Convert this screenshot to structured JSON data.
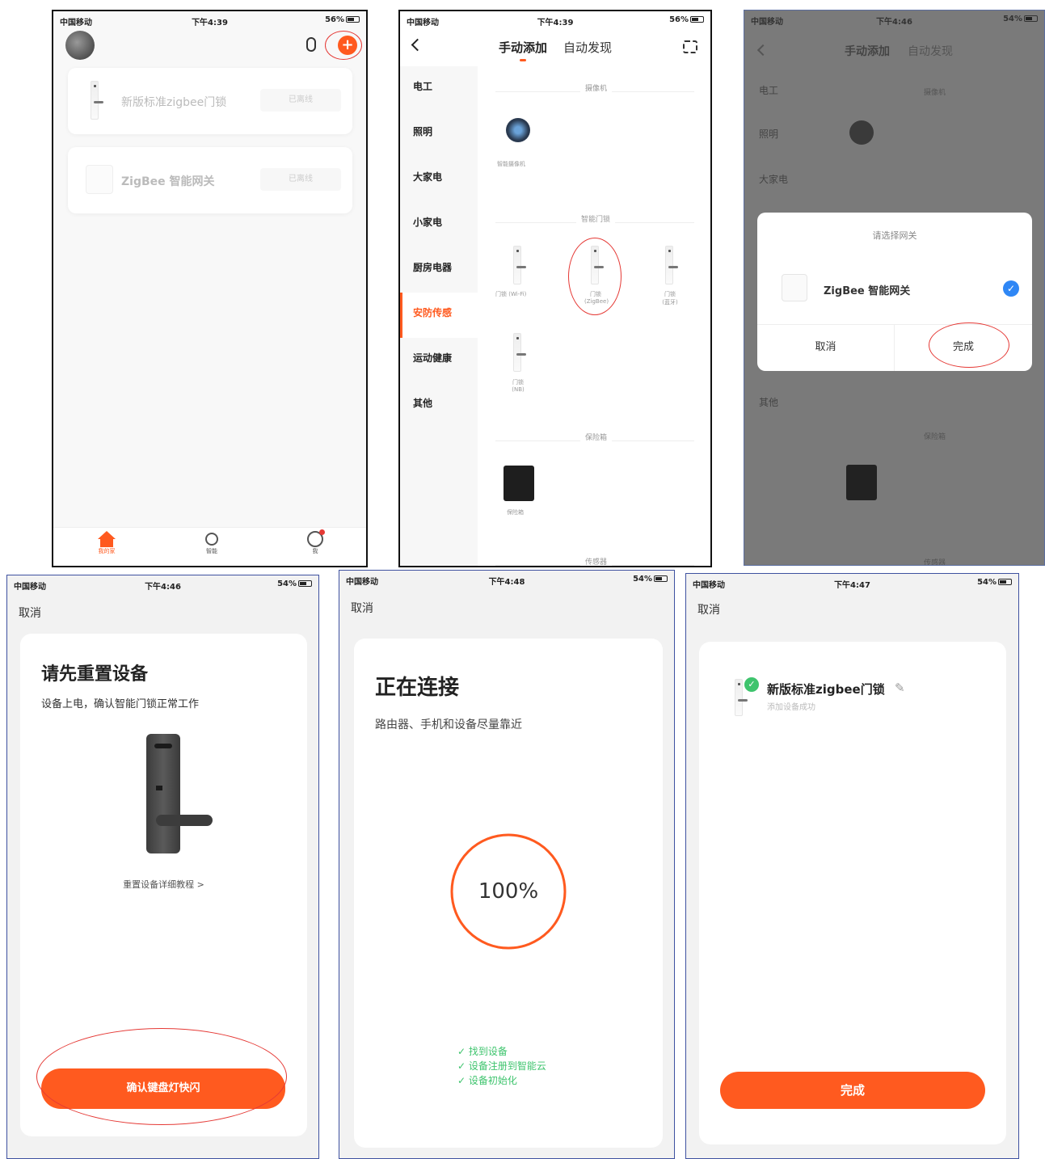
{
  "status": {
    "carrier": "中国移动",
    "p1_time": "下午4:39",
    "p1_batt": "56%",
    "p2_time": "下午4:39",
    "p2_batt": "56%",
    "p3_time": "下午4:46",
    "p3_batt": "54%",
    "p4_time": "下午4:46",
    "p4_batt": "54%",
    "p5_time": "下午4:48",
    "p5_batt": "54%",
    "p6_time": "下午4:47",
    "p6_batt": "54%"
  },
  "home": {
    "devices": [
      {
        "name": "新版标准zigbee门锁",
        "status": "已离线"
      },
      {
        "name": "ZigBee 智能网关",
        "status": "已离线"
      }
    ],
    "tabs": [
      "我的家",
      "智能",
      "我"
    ]
  },
  "add": {
    "tabs": [
      "手动添加",
      "自动发现"
    ],
    "categories": [
      "电工",
      "照明",
      "大家电",
      "小家电",
      "厨房电器",
      "安防传感",
      "运动健康",
      "其他"
    ],
    "active_category": "安防传感",
    "sections": {
      "camera": "摄像机",
      "camera_item": "智能摄像机",
      "lock": "智能门锁",
      "lock_items": [
        "门锁 (Wi-Fi)",
        "门锁\n(ZigBee)",
        "门锁\n(蓝牙)",
        "门锁\n(NB)"
      ],
      "safe": "保险箱",
      "safe_item": "保险箱",
      "sensor": "传感器"
    }
  },
  "gateway_dialog": {
    "title": "请选择网关",
    "gateway": "ZigBee 智能网关",
    "cancel": "取消",
    "done": "完成"
  },
  "reset": {
    "cancel": "取消",
    "title": "请先重置设备",
    "subtitle": "设备上电，确认智能门锁正常工作",
    "link": "重置设备详细教程 >",
    "button": "确认键盘灯快闪"
  },
  "connecting": {
    "cancel": "取消",
    "title": "正在连接",
    "subtitle": "路由器、手机和设备尽量靠近",
    "progress": "100%",
    "progress_value": 1.0,
    "steps": [
      "找到设备",
      "设备注册到智能云",
      "设备初始化"
    ]
  },
  "success": {
    "cancel": "取消",
    "device": "新版标准zigbee门锁",
    "message": "添加设备成功",
    "button": "完成"
  },
  "colors": {
    "accent": "#ff5a1f",
    "check_blue": "#2f87f5",
    "success_green": "#3ec46d"
  }
}
